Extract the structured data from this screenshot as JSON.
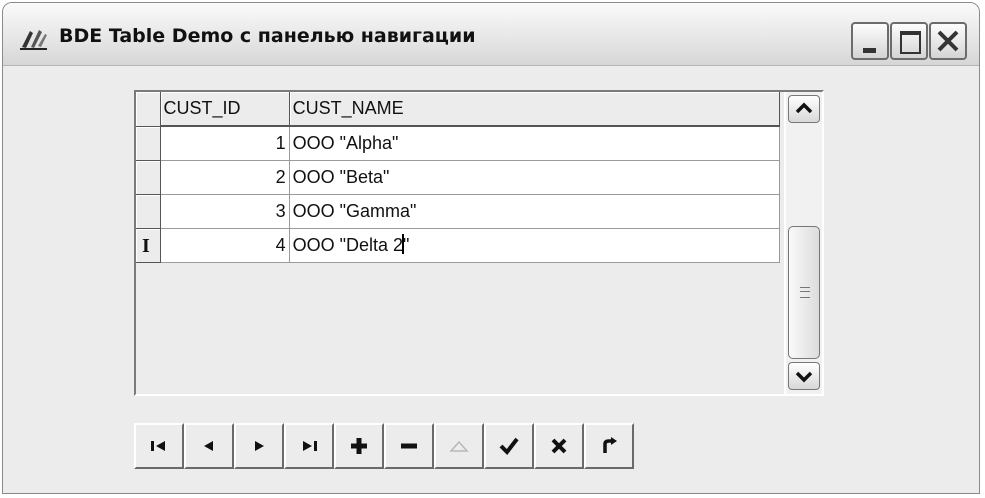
{
  "window": {
    "title": "BDE Table Demo с панелью навигации"
  },
  "grid": {
    "columns": [
      "CUST_ID",
      "CUST_NAME"
    ],
    "rows": [
      {
        "id": "1",
        "name": "OOO \"Alpha\""
      },
      {
        "id": "2",
        "name": "OOO \"Beta\""
      },
      {
        "id": "3",
        "name": "OOO \"Gamma\""
      },
      {
        "id": "4",
        "name_before_caret": "OOO \"Delta 2",
        "name_after_caret": "\"",
        "indicator": "I"
      }
    ]
  },
  "navigator": {
    "buttons": [
      "first",
      "prior",
      "next",
      "last",
      "insert",
      "delete",
      "edit",
      "post",
      "cancel",
      "refresh"
    ],
    "disabled": [
      "edit"
    ]
  },
  "colors": {
    "window_bg": "#ececec",
    "glyph": "#111111",
    "glyph_disabled": "#b8b8b8"
  }
}
